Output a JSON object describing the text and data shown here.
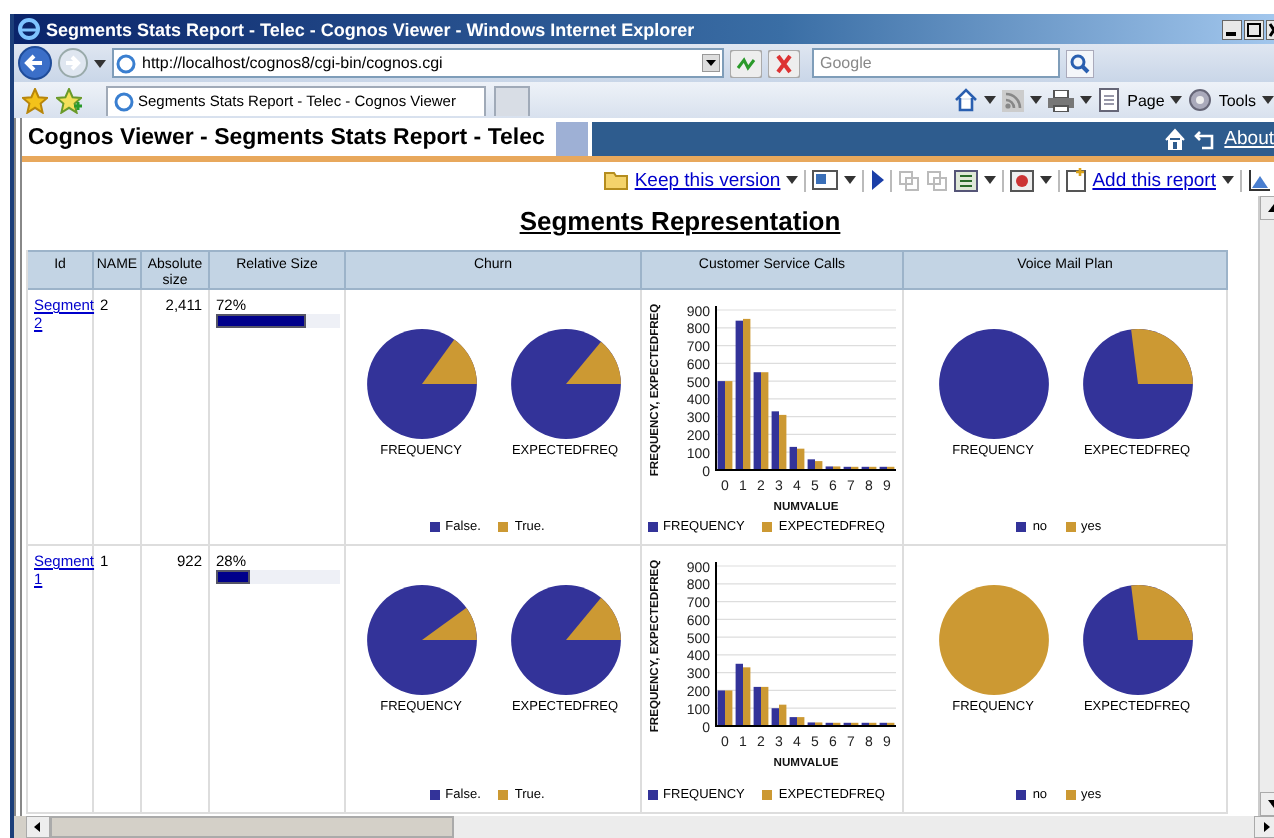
{
  "window": {
    "title": "Segments Stats Report - Telec - Cognos Viewer - Windows Internet Explorer"
  },
  "address_bar": {
    "url": "http://localhost/cognos8/cgi-bin/cognos.cgi",
    "search_placeholder": "Google"
  },
  "tabs": [
    {
      "label": "Segments Stats Report - Telec - Cognos Viewer",
      "selected": true
    }
  ],
  "command_bar": [
    "Page",
    "Tools"
  ],
  "viewer": {
    "title": "Cognos Viewer - Segments Stats Report - Telec",
    "link": "About"
  },
  "toolbar": {
    "keep_link": "Keep this version",
    "add_link": "Add this report"
  },
  "report": {
    "title": "Segments Representation",
    "columns": [
      "Id",
      "NAME",
      "Absolute size",
      "Relative Size",
      "Churn",
      "Customer Service Calls",
      "Voice Mail Plan"
    ],
    "rows": [
      {
        "id": "Segment 2",
        "name": "2",
        "absolute_size": "2,411",
        "relative_size": "72%",
        "level": 0.72,
        "churn": {
          "labels": [
            "FREQUENCY",
            "EXPECTEDFREQ"
          ],
          "legend": [
            {
              "label": "False.",
              "color": "#333399"
            },
            {
              "label": "True.",
              "color": "#cc9933"
            }
          ]
        },
        "calls": {
          "chart_data": {
            "type": "bar",
            "xlabel": "NUMVALUE",
            "ylabel": "FREQUENCY, EXPECTEDFREQ",
            "categories": [
              "0",
              "1",
              "2",
              "3",
              "4",
              "5",
              "6",
              "7",
              "8",
              "9"
            ],
            "yticks": [
              0,
              100,
              200,
              300,
              400,
              500,
              600,
              700,
              800,
              900
            ],
            "ylim": [
              0,
              900
            ],
            "grid": true,
            "series": [
              {
                "name": "FREQUENCY",
                "color": "#333399",
                "values": [
                  500,
                  840,
                  550,
                  330,
                  130,
                  60,
                  20,
                  10,
                  10,
                  10
                ]
              },
              {
                "name": "EXPECTEDFREQ",
                "color": "#cc9933",
                "values": [
                  500,
                  850,
                  550,
                  310,
                  120,
                  50,
                  20,
                  10,
                  10,
                  10
                ]
              }
            ]
          }
        },
        "voice_mail": {
          "labels": [
            "FREQUENCY",
            "EXPECTEDFREQ"
          ],
          "legend": [
            {
              "label": "no",
              "color": "#333399"
            },
            {
              "label": "yes",
              "color": "#cc9933"
            }
          ]
        }
      },
      {
        "id": "Segment 1",
        "name": "1",
        "absolute_size": "922",
        "relative_size": "28%",
        "level": 0.28,
        "churn": {
          "labels": [
            "FREQUENCY",
            "EXPECTEDFREQ"
          ],
          "legend": [
            {
              "label": "False.",
              "color": "#333399"
            },
            {
              "label": "True.",
              "color": "#cc9933"
            }
          ]
        },
        "calls": {
          "chart_data": {
            "type": "bar",
            "xlabel": "NUMVALUE",
            "ylabel": "FREQUENCY, EXPECTEDFREQ",
            "categories": [
              "0",
              "1",
              "2",
              "3",
              "4",
              "5",
              "6",
              "7",
              "8",
              "9"
            ],
            "yticks": [
              0,
              100,
              200,
              300,
              400,
              500,
              600,
              700,
              800,
              900
            ],
            "ylim": [
              0,
              900
            ],
            "grid": true,
            "series": [
              {
                "name": "FREQUENCY",
                "color": "#333399",
                "values": [
                  200,
                  350,
                  220,
                  100,
                  50,
                  20,
                  10,
                  10,
                  10,
                  10
                ]
              },
              {
                "name": "EXPECTEDFREQ",
                "color": "#cc9933",
                "values": [
                  200,
                  330,
                  220,
                  120,
                  50,
                  20,
                  10,
                  10,
                  10,
                  10
                ]
              }
            ]
          }
        },
        "voice_mail": {
          "labels": [
            "FREQUENCY",
            "EXPECTEDFREQ"
          ],
          "legend": [
            {
              "label": "no",
              "color": "#333399"
            },
            {
              "label": "yes",
              "color": "#cc9933"
            }
          ]
        }
      }
    ]
  }
}
